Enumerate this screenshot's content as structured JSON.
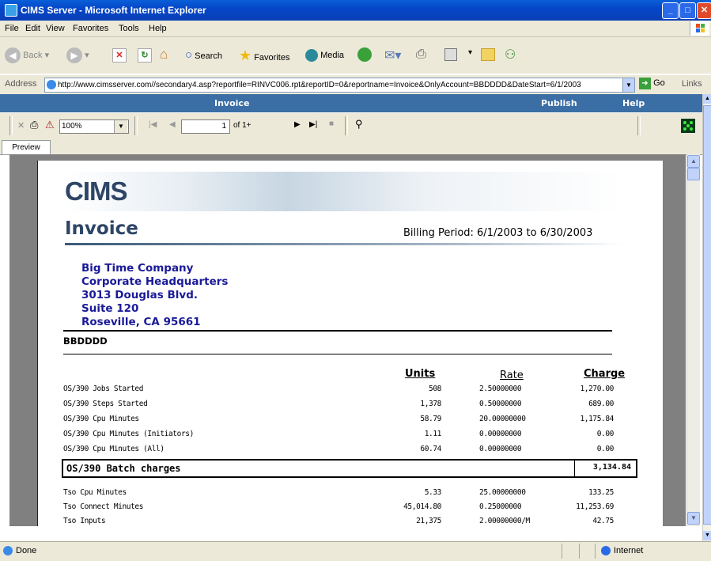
{
  "window": {
    "title": "CIMS Server - Microsoft Internet Explorer"
  },
  "menu": [
    "File",
    "Edit",
    "View",
    "Favorites",
    "Tools",
    "Help"
  ],
  "toolbar": {
    "back": "Back",
    "search": "Search",
    "favorites": "Favorites",
    "media": "Media"
  },
  "address": {
    "label": "Address",
    "url": "http://www.cimsserver.com//secondary4.asp?reportfile=RINVC006.rpt&reportID=0&reportname=Invoice&OnlyAccount=BBDDDD&DateStart=6/1/2003",
    "go": "Go",
    "links": "Links"
  },
  "reportnav": {
    "title": "Invoice",
    "publish": "Publish",
    "help": "Help"
  },
  "viewer": {
    "zoom": "100%",
    "page": "1",
    "of": "of 1+",
    "tab": "Preview"
  },
  "report": {
    "logo": "CIMS",
    "title": "Invoice",
    "billing_period": "Billing Period: 6/1/2003 to 6/30/2003",
    "address_lines": [
      "Big Time Company",
      "Corporate Headquarters",
      "3013 Douglas Blvd.",
      "Suite 120",
      "Roseville, CA  95661"
    ],
    "account": "BBDDDD",
    "columns": {
      "units": "Units",
      "rate": "Rate",
      "charge": "Charge"
    },
    "batch_rows": [
      {
        "desc": "OS/390 Jobs Started",
        "units": "508",
        "rate": "2.50000000",
        "charge": "1,270.00"
      },
      {
        "desc": "OS/390 Steps Started",
        "units": "1,378",
        "rate": "0.50000000",
        "charge": "689.00"
      },
      {
        "desc": "OS/390 Cpu Minutes",
        "units": "58.79",
        "rate": "20.00000000",
        "charge": "1,175.84"
      },
      {
        "desc": "OS/390 Cpu Minutes (Initiators)",
        "units": "1.11",
        "rate": "0.00000000",
        "charge": "0.00"
      },
      {
        "desc": "OS/390 Cpu Minutes (All)",
        "units": "60.74",
        "rate": "0.00000000",
        "charge": "0.00"
      }
    ],
    "batch_total": {
      "label": "OS/390 Batch charges",
      "value": "3,134.84"
    },
    "tso_rows": [
      {
        "desc": "Tso Cpu Minutes",
        "units": "5.33",
        "rate": "25.00000000",
        "charge": "133.25"
      },
      {
        "desc": "Tso Connect Minutes",
        "units": "45,014.80",
        "rate": "0.25000000",
        "charge": "11,253.69"
      },
      {
        "desc": "Tso Inputs",
        "units": "21,375",
        "rate": "2.00000000/M",
        "charge": "42.75"
      }
    ]
  },
  "status": {
    "text": "Done",
    "zone": "Internet"
  }
}
